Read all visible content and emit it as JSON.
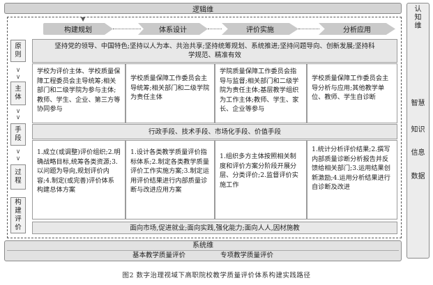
{
  "top_bar": "逻辑维",
  "stages": [
    "构建规划",
    "体系设计",
    "评价实施",
    "分析应用"
  ],
  "left_labels": {
    "principle": "原则",
    "subject": "主体",
    "means": "手段",
    "process": "过程",
    "evaluation": "构建评价"
  },
  "principle_text": "坚持党的领导、中国特色;坚持以人为本、共治共享;坚持统筹规划、系统推进;坚持问题导向、创新发展;坚持科学规范、精准有效",
  "subjects": [
    "学校为评价主体、学校质量保障工程委员会主导统筹;相关部门和二级学院为参与主体;教师、学生、企业、第三方等协同参与",
    "学校质量保障工作委员会主导统筹;相关部门和二级学院为责任主体",
    "学院质量保障工作委员会指导与监督;相关部门和二级学院为责任主体;基层教学组织为工作主体;教师、学生、家长、企业等参与",
    "学校质量保障工作委员会主导分析与应用;其他教学单位、教师、学生自诊断"
  ],
  "means_text": "行政手段、技术手段、市场化手段、价值手段",
  "processes": [
    "1.成立(或调整)评价组织;2.明确战略目标,统筹各类资源;3.以问题为导向,规划评价内容;4.制定(或完善)评价体系构建总体方案",
    "1.设计各类教学质量评价指标体系;2.制定各类教学质量评价工作实施方案;3.制定运用评价结果进行内部质量诊断与改进应用方案",
    "1.组织多方主体按照相关制度和评价方案分阶段开展分层、分类评价;2.监督评价实施工作",
    "1.统计分析评价结果;2.撰写内部质量诊断分析报告并反馈给相关部门;3.运用结果创新激励;4.运用分析结果进行自诊断及改进"
  ],
  "evaluation_text": "面向市场,促进就业;面向实践,强化能力;面向人人,因材施教",
  "bottom_bar": "系统维",
  "bottom_items": [
    "基本教学质量评价",
    "专项教学质量评价"
  ],
  "right_col": {
    "title": "认知维",
    "items": [
      "智慧",
      "知识",
      "信息",
      "数据"
    ]
  },
  "caption": "图2  数字治理视域下高职院校教学质量评价体系构建实践路径"
}
